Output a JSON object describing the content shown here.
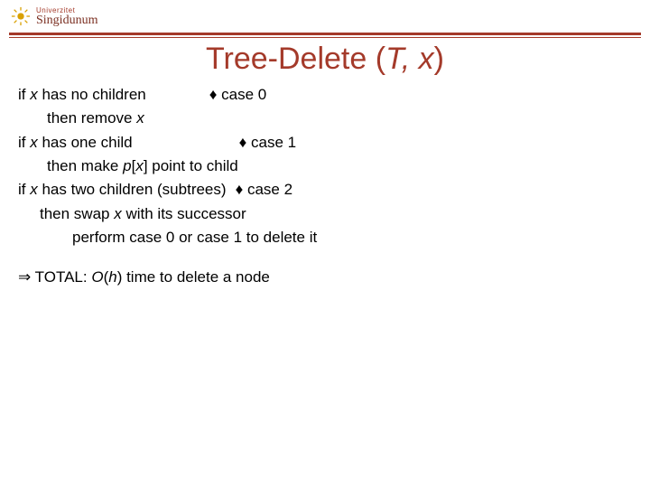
{
  "logo": {
    "uni_label": "Univerzitet",
    "name": "Singidunum"
  },
  "title": {
    "prefix": "Tree-Delete (",
    "arg1": "T",
    "comma": ", ",
    "arg2": "x",
    "suffix": ")"
  },
  "lines": {
    "l1a": "if ",
    "l1b": "x",
    "l1c": " has no children",
    "c0": "♦ case 0",
    "l2a": "then remove ",
    "l2b": "x",
    "l3a": "if ",
    "l3b": "x",
    "l3c": " has one child",
    "c1": "♦ case 1",
    "l4a": "then make ",
    "l4b": "p",
    "l4c": "[",
    "l4d": "x",
    "l4e": "] point to child",
    "l5a": "if ",
    "l5b": "x",
    "l5c": " has two children (subtrees)",
    "c2": "♦ case 2",
    "l6a": "then swap ",
    "l6b": "x",
    "l6c": " with its successor",
    "l7": "perform case 0 or case 1 to delete it",
    "t1": "⇒ TOTAL: ",
    "t2": "O",
    "t3": "(",
    "t4": "h",
    "t5": ") time to delete a node"
  }
}
